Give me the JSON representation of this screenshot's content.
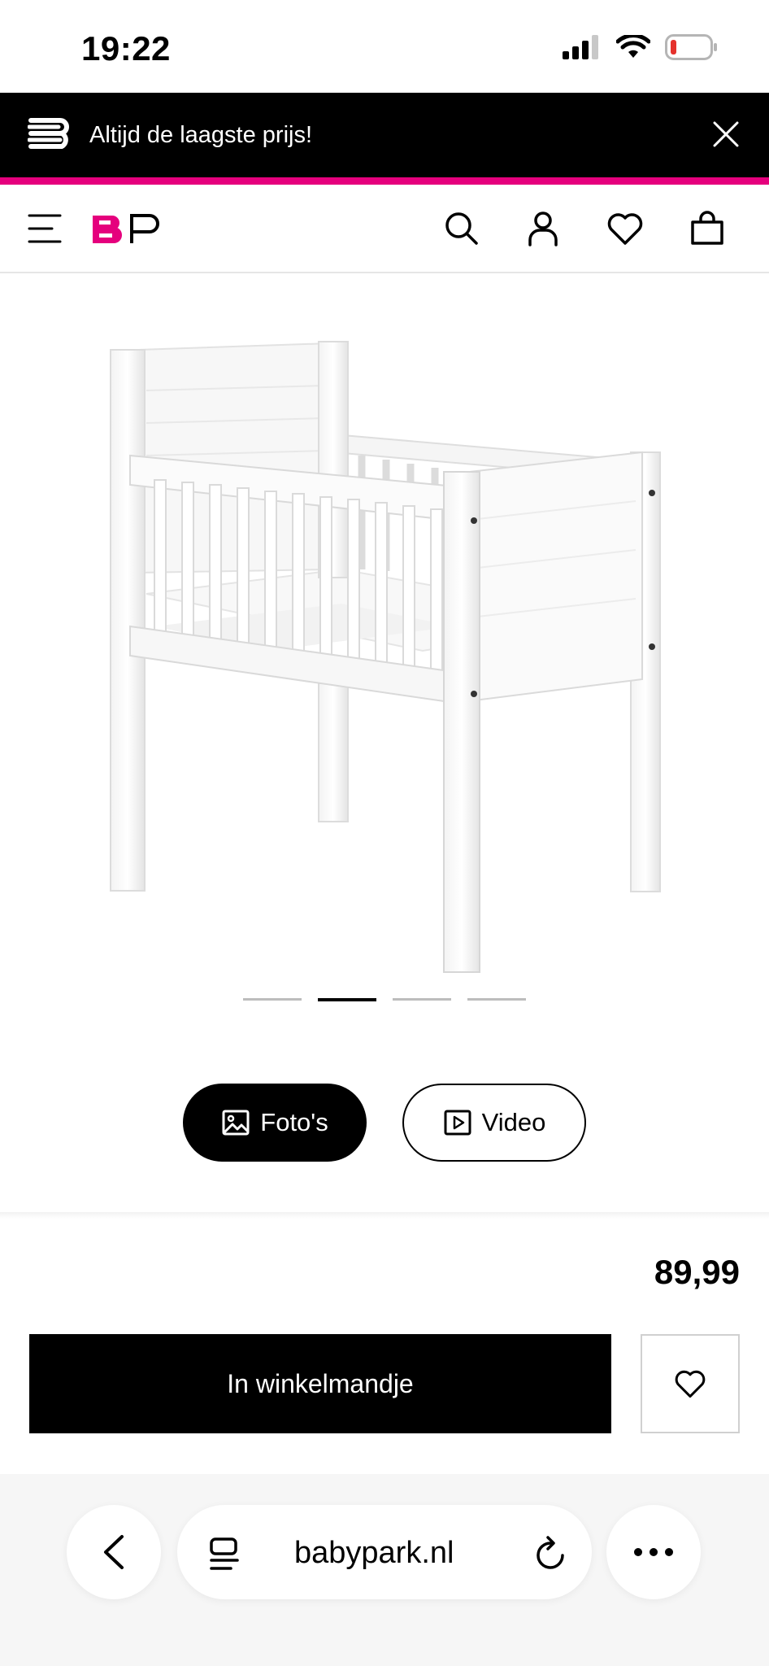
{
  "status_bar": {
    "time": "19:22"
  },
  "promo": {
    "text": "Altijd de laagste prijs!"
  },
  "header": {
    "logo_text": "BP",
    "accent_color": "#e5007d"
  },
  "gallery": {
    "slide_count": 4,
    "active_slide": 2
  },
  "media_toggle": {
    "photos_label": "Foto's",
    "video_label": "Video",
    "active": "photos"
  },
  "product": {
    "price": "89,99"
  },
  "actions": {
    "add_to_cart_label": "In winkelmandje"
  },
  "browser": {
    "url": "babypark.nl"
  },
  "icons": {
    "menu": "hamburger-icon",
    "search": "search-icon",
    "account": "user-icon",
    "wishlist": "heart-icon",
    "cart": "bag-icon",
    "close": "close-icon",
    "back": "chevron-left-icon",
    "reader": "reader-icon",
    "reload": "reload-icon",
    "more": "more-icon"
  }
}
